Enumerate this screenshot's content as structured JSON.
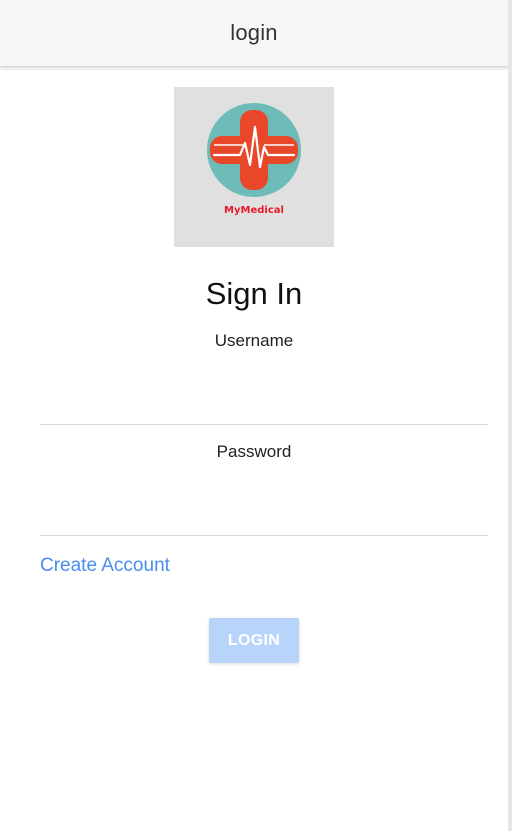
{
  "header": {
    "title": "login"
  },
  "logo": {
    "text": "MyMedical",
    "icon": "medical-cross-heartbeat-icon",
    "colors": {
      "circle": "#6dbcb8",
      "cross": "#e9472a",
      "heartbeat": "#ffffff",
      "text": "#e8182c",
      "background": "#e0e0e0"
    }
  },
  "form": {
    "heading": "Sign In",
    "username": {
      "label": "Username",
      "value": "",
      "placeholder": ""
    },
    "password": {
      "label": "Password",
      "value": "",
      "placeholder": ""
    },
    "create_account_label": "Create Account",
    "login_label": "LOGIN"
  },
  "colors": {
    "link": "#4a8cf0",
    "button_disabled": "#b9d4fb",
    "header_background": "#f7f7f7"
  }
}
